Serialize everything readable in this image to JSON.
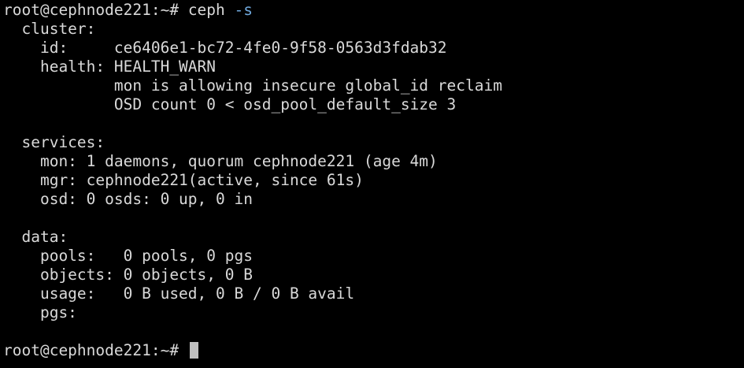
{
  "terminal": {
    "command": {
      "prompt": "root@cephnode221:~# ",
      "name": "ceph ",
      "flag": "-s"
    },
    "cluster": {
      "header": "  cluster:",
      "id": "    id:     ce6406e1-bc72-4fe0-9f58-0563d3fdab32",
      "health": "    health: HEALTH_WARN",
      "warning_1": "            mon is allowing insecure global_id reclaim",
      "warning_2": "            OSD count 0 < osd_pool_default_size 3"
    },
    "services": {
      "header": "  services:",
      "mon": "    mon: 1 daemons, quorum cephnode221 (age 4m)",
      "mgr": "    mgr: cephnode221(active, since 61s)",
      "osd": "    osd: 0 osds: 0 up, 0 in"
    },
    "data": {
      "header": "  data:",
      "pools": "    pools:   0 pools, 0 pgs",
      "objects": "    objects: 0 objects, 0 B",
      "usage": "    usage:   0 B used, 0 B / 0 B avail",
      "pgs": "    pgs:"
    },
    "final_prompt": "root@cephnode221:~# "
  },
  "colors": {
    "background": "#000000",
    "text": "#d9d9d9",
    "flag": "#6fa8dc",
    "cursor": "#c0c0c0"
  }
}
